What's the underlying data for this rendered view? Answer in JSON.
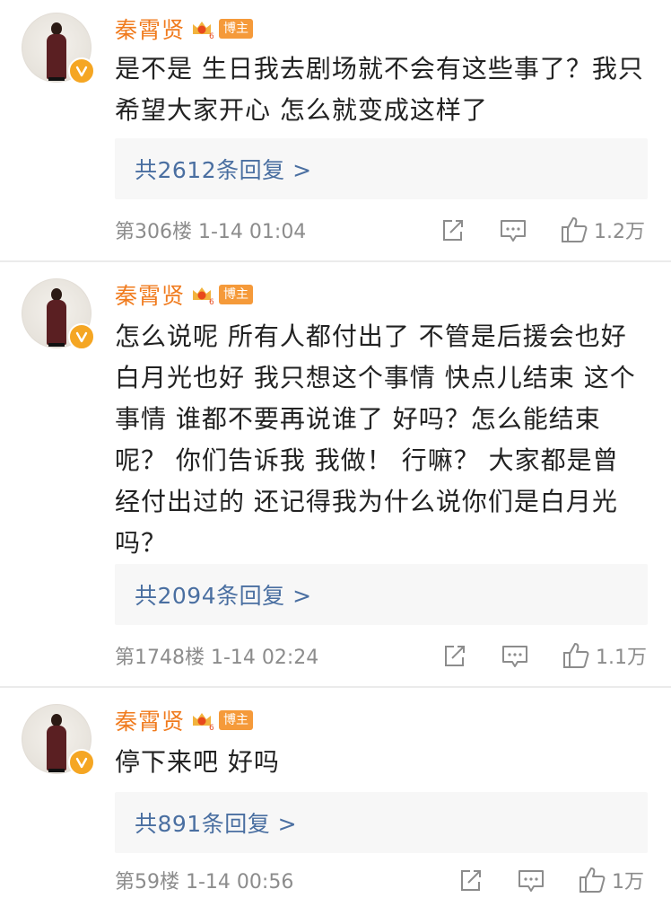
{
  "comments": [
    {
      "username": "秦霄贤",
      "badge_label": "博主",
      "text": "是不是  生日我去剧场就不会有这些事了？我只希望大家开心    怎么就变成这样了",
      "reply_link": "共2612条回复 >",
      "meta": "第306楼  1-14 01:04",
      "likes": "1.2万"
    },
    {
      "username": "秦霄贤",
      "badge_label": "博主",
      "text": "怎么说呢  所有人都付出了  不管是后援会也好    白月光也好  我只想这个事情    快点儿结束    这个事情  谁都不要再说谁了  好吗？怎么能结束呢？  你们告诉我  我做！  行嘛？    大家都是曾经付出过的  还记得我为什么说你们是白月光吗？",
      "reply_link": "共2094条回复 >",
      "meta": "第1748楼  1-14 02:24",
      "likes": "1.1万"
    },
    {
      "username": "秦霄贤",
      "badge_label": "博主",
      "text": "停下来吧  好吗",
      "reply_link": "共891条回复 >",
      "meta": "第59楼  1-14 00:56",
      "likes": "1万"
    }
  ],
  "icons": {
    "share": "share-icon",
    "comment": "comment-icon",
    "like": "thumbs-up-icon",
    "vip": "crown-vip-icon",
    "verified": "verified-v-icon"
  },
  "colors": {
    "username": "#f07b1e",
    "host_badge": "#f59a3a",
    "reply_link": "#4a6fa1",
    "meta": "#8c8c8c",
    "reply_bg": "#f7f7f7"
  }
}
